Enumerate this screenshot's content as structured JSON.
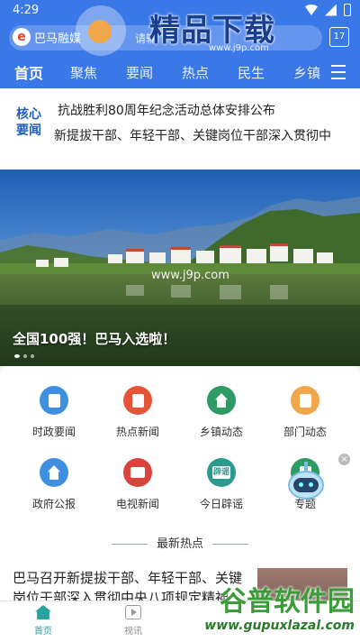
{
  "status_bar": {
    "time": "4:29"
  },
  "header": {
    "brand": "巴马融媒",
    "search_text": "请输",
    "calendar_day": "17",
    "tabs": [
      "首页",
      "聚焦",
      "要闻",
      "热点",
      "民生",
      "乡镇"
    ],
    "active_tab": "首页"
  },
  "key_news": {
    "badge_line1": "核心",
    "badge_line2": "要闻",
    "items": [
      "抗战胜利80周年纪念活动总体安排公布",
      "新提拔干部、年轻干部、关键岗位干部深入贯彻中"
    ]
  },
  "banner": {
    "caption": "全国100强！巴马入选啦！"
  },
  "grid": {
    "items": [
      {
        "label": "时政要闻",
        "icon": "doc-icon",
        "color": "#3f8fe0"
      },
      {
        "label": "热点新闻",
        "icon": "news-icon",
        "color": "#e55439"
      },
      {
        "label": "乡镇动态",
        "icon": "building-icon",
        "color": "#2e9a64"
      },
      {
        "label": "部门动态",
        "icon": "report-icon",
        "color": "#f0a64a"
      },
      {
        "label": "政府公报",
        "icon": "gov-icon",
        "color": "#3f8fe0"
      },
      {
        "label": "电视新闻",
        "icon": "tv-icon",
        "color": "#d9453b"
      },
      {
        "label": "今日辟谣",
        "icon": "rumor-icon",
        "color": "#2b9a8f"
      },
      {
        "label": "专题",
        "icon": "topic-icon",
        "color": "#2e9a64"
      }
    ],
    "rumor_glyph": "辟谣"
  },
  "hot": {
    "title": "最新热点",
    "headline": "巴马召开新提拔干部、年轻干部、关键岗位干部深入贯彻中央八项规定精神"
  },
  "bottom_nav": {
    "home": "首页",
    "video": "视讯"
  },
  "watermarks": {
    "top_text": "精品下载",
    "top_url": "www.j9p.com",
    "bottom_cn": "谷普软件园",
    "bottom_en": "www.gupuxlazal.com"
  }
}
